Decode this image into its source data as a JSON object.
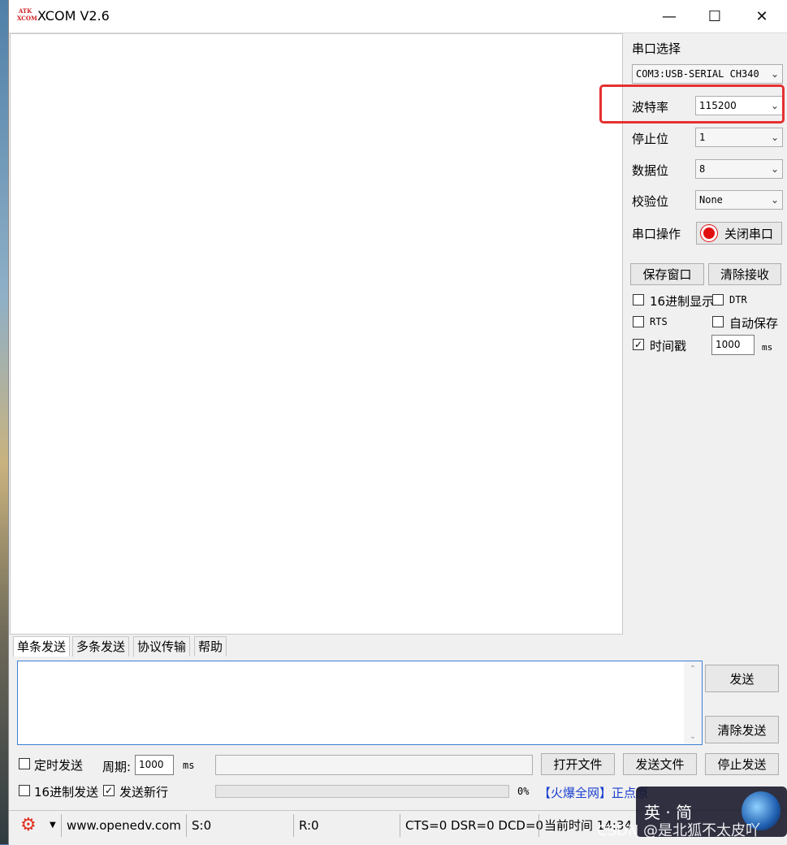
{
  "window": {
    "title": "XCOM V2.6",
    "logo_top": "ATK",
    "logo_bottom": "XCOM",
    "minimize": "—",
    "maximize": "☐",
    "close": "✕"
  },
  "settings": {
    "port_select_label": "串口选择",
    "port_value": "COM3:USB-SERIAL CH340",
    "baud_label": "波特率",
    "baud_value": "115200",
    "stopbits_label": "停止位",
    "stopbits_value": "1",
    "databits_label": "数据位",
    "databits_value": "8",
    "parity_label": "校验位",
    "parity_value": "None",
    "port_op_label": "串口操作",
    "close_port_button": "关闭串口"
  },
  "actions": {
    "save_window": "保存窗口",
    "clear_receive": "清除接收"
  },
  "options": {
    "hex_display": {
      "label": "16进制显示",
      "checked": false
    },
    "dtr": {
      "label": "DTR",
      "checked": false
    },
    "rts": {
      "label": "RTS",
      "checked": false
    },
    "auto_save": {
      "label": "自动保存",
      "checked": false
    },
    "timestamp": {
      "label": "时间戳",
      "checked": true,
      "value": "1000",
      "unit": "ms"
    }
  },
  "tabs": [
    "单条发送",
    "多条发送",
    "协议传输",
    "帮助"
  ],
  "send": {
    "text": "",
    "send_button": "发送",
    "clear_send_button": "清除发送",
    "timed_send_label": "定时发送",
    "period_label": "周期:",
    "period_value": "1000",
    "period_unit": "ms",
    "file_path": "",
    "open_file_button": "打开文件",
    "send_file_button": "发送文件",
    "stop_send_button": "停止发送",
    "hex_send_label": "16进制发送",
    "newline_label": "发送新行",
    "progress_text": "0%",
    "progress": 0,
    "ad_text": "【火爆全网】正点原"
  },
  "statusbar": {
    "url": "www.openedv.com",
    "sent": "S:0",
    "received": "R:0",
    "lines": "CTS=0 DSR=0 DCD=0",
    "time": "当前时间 14:34"
  },
  "overlay": {
    "ime": "英 · 简",
    "watermark": "CSDN @是北狐不太皮吖"
  }
}
